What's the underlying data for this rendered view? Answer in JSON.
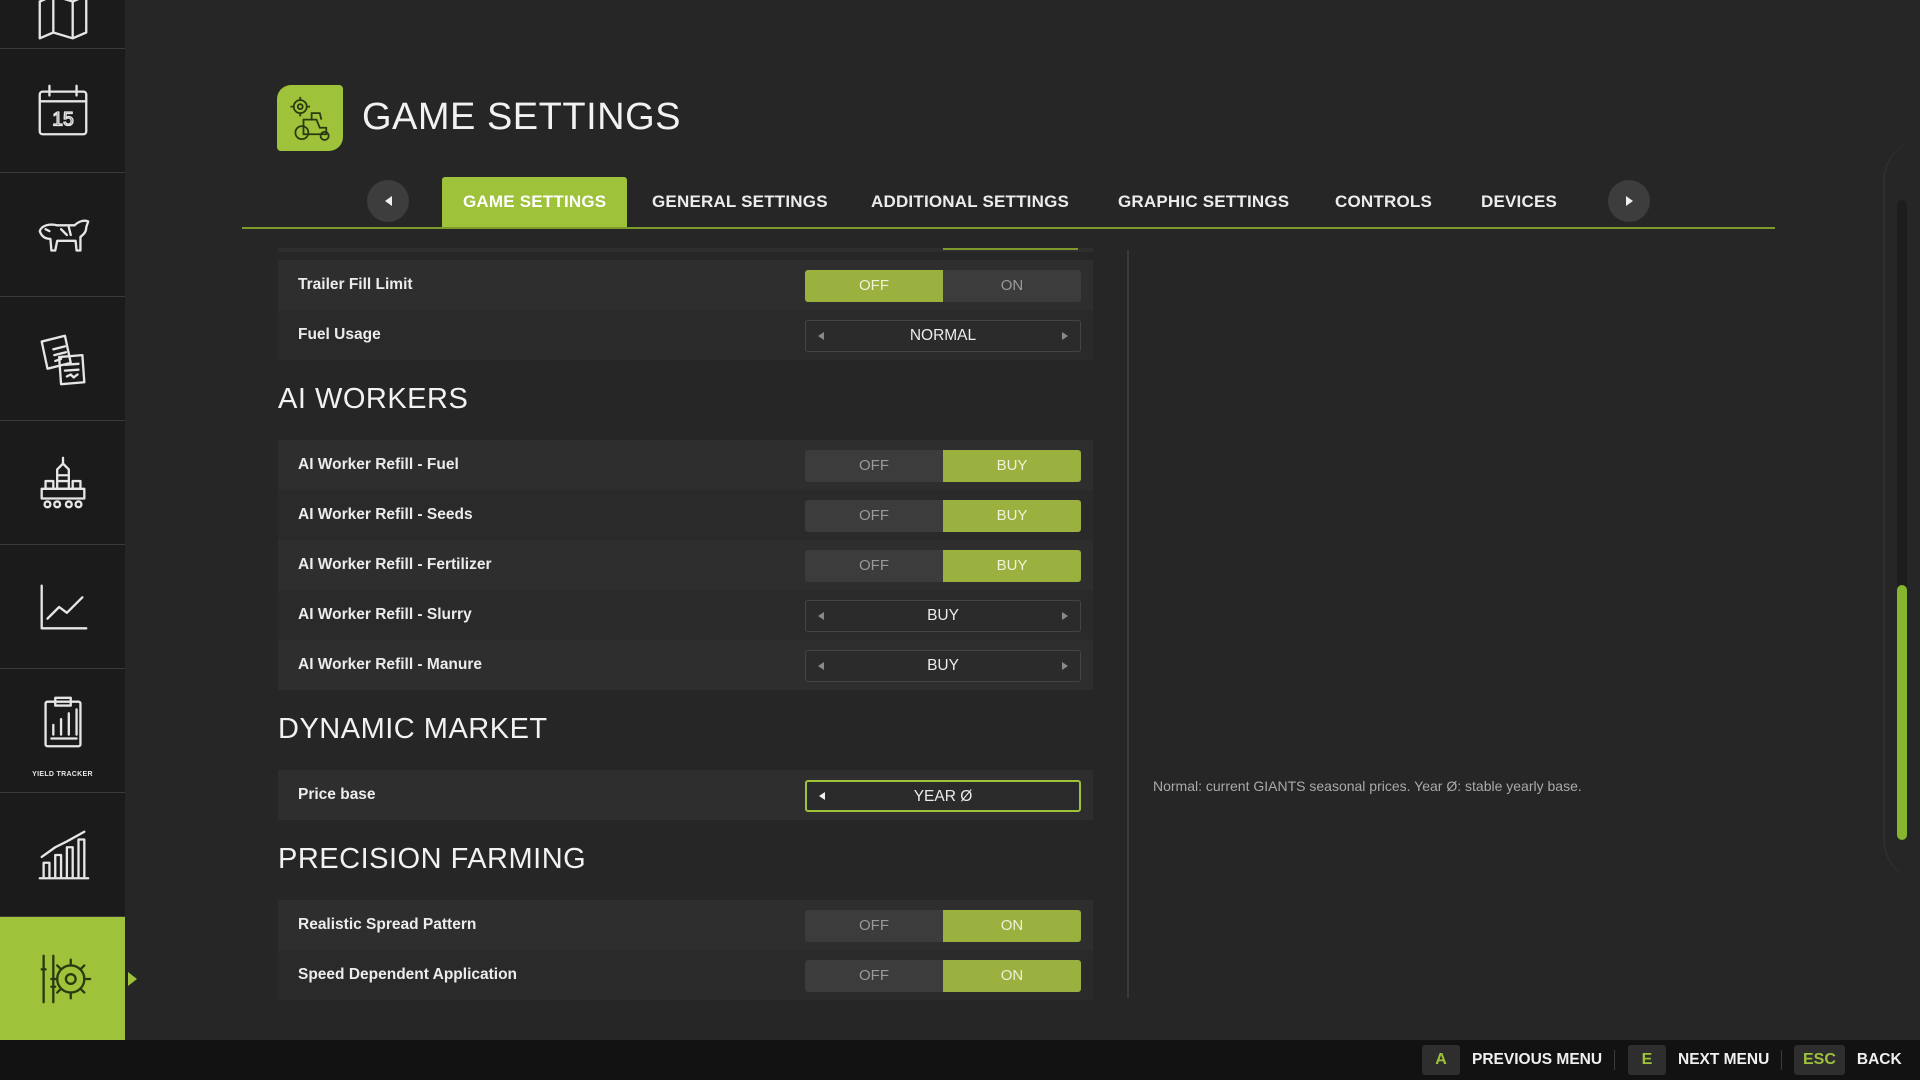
{
  "colors": {
    "accent": "#9ec23a",
    "toggle_selected": "#9ab03f",
    "background": "#262626",
    "sidebar": "#1b1b1b"
  },
  "sidebar": {
    "items": [
      {
        "icon": "map-icon"
      },
      {
        "icon": "calendar-icon",
        "text": "15"
      },
      {
        "icon": "cow-icon"
      },
      {
        "icon": "contracts-icon"
      },
      {
        "icon": "production-icon"
      },
      {
        "icon": "line-chart-icon"
      },
      {
        "icon": "yield-tracker-icon",
        "caption": "YIELD TRACKER"
      },
      {
        "icon": "bar-chart-icon"
      },
      {
        "icon": "settings-icon",
        "active": true
      }
    ]
  },
  "header": {
    "title": "GAME SETTINGS",
    "icon": "tractor-gear-icon"
  },
  "tabs": [
    {
      "label": "GAME SETTINGS",
      "active": true
    },
    {
      "label": "GENERAL SETTINGS"
    },
    {
      "label": "ADDITIONAL SETTINGS"
    },
    {
      "label": "GRAPHIC SETTINGS"
    },
    {
      "label": "CONTROLS"
    },
    {
      "label": "DEVICES"
    }
  ],
  "settings": {
    "trailer_fill_limit": {
      "label": "Trailer Fill Limit",
      "options": [
        "OFF",
        "ON"
      ],
      "selected": "OFF"
    },
    "fuel_usage": {
      "label": "Fuel Usage",
      "value": "NORMAL"
    },
    "ai_workers_title": "AI WORKERS",
    "ai_fuel": {
      "label": "AI Worker Refill - Fuel",
      "options": [
        "OFF",
        "BUY"
      ],
      "selected": "BUY"
    },
    "ai_seeds": {
      "label": "AI Worker Refill - Seeds",
      "options": [
        "OFF",
        "BUY"
      ],
      "selected": "BUY"
    },
    "ai_fertilizer": {
      "label": "AI Worker Refill - Fertilizer",
      "options": [
        "OFF",
        "BUY"
      ],
      "selected": "BUY"
    },
    "ai_slurry": {
      "label": "AI Worker Refill - Slurry",
      "value": "BUY"
    },
    "ai_manure": {
      "label": "AI Worker Refill - Manure",
      "value": "BUY"
    },
    "dynamic_market_title": "DYNAMIC MARKET",
    "price_base": {
      "label": "Price base",
      "value": "YEAR Ø"
    },
    "precision_farming_title": "PRECISION FARMING",
    "spread_pattern": {
      "label": "Realistic Spread Pattern",
      "options": [
        "OFF",
        "ON"
      ],
      "selected": "ON"
    },
    "speed_dependent": {
      "label": "Speed Dependent Application",
      "options": [
        "OFF",
        "ON"
      ],
      "selected": "ON"
    }
  },
  "help_text": "Normal: current GIANTS seasonal prices. Year Ø: stable yearly base.",
  "bottom_bar": {
    "hints": [
      {
        "key": "A",
        "label": "PREVIOUS MENU"
      },
      {
        "key": "E",
        "label": "NEXT MENU"
      },
      {
        "key": "ESC",
        "label": "BACK"
      }
    ]
  }
}
